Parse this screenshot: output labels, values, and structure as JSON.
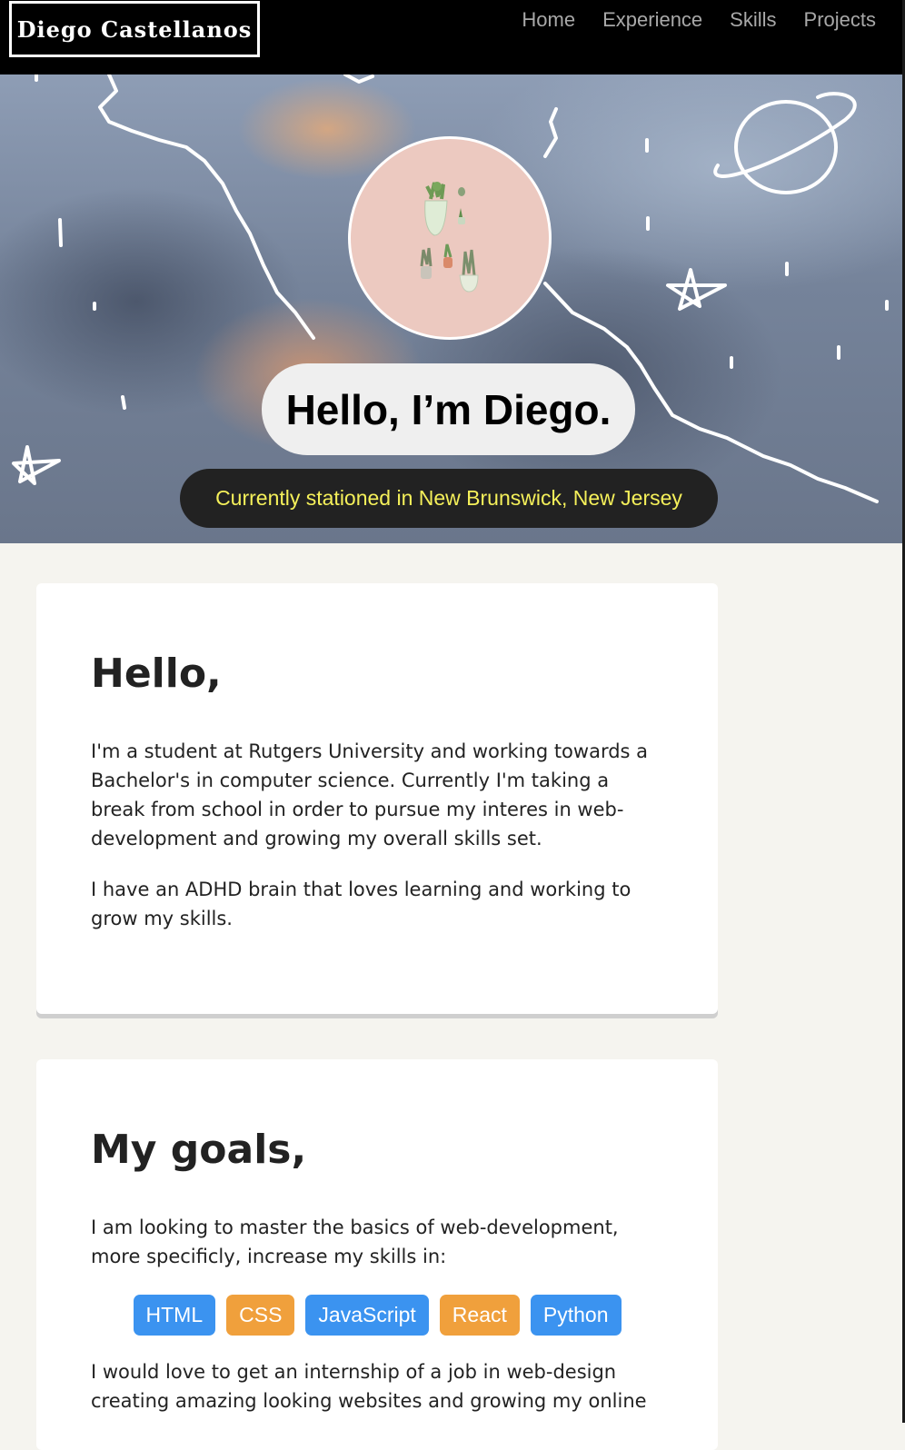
{
  "nav": {
    "brand": "Diego Castellanos",
    "links": [
      {
        "label": "Home"
      },
      {
        "label": "Experience"
      },
      {
        "label": "Skills"
      },
      {
        "label": "Projects"
      }
    ]
  },
  "hero": {
    "avatar_icon": "succulents-illustration",
    "title": "Hello, I’m Diego.",
    "subtitle": "Currently stationed in New Brunswick, New Jersey"
  },
  "about": {
    "heading": "Hello,",
    "paragraphs": [
      "I'm a student at Rutgers University and working towards a Bachelor's in computer science. Currently I'm taking a break from school in order to pursue my interes in web-development and growing my overall skills set.",
      "I have an ADHD brain that loves learning and working to grow my skills."
    ]
  },
  "goals": {
    "heading": "My goals,",
    "intro": "I am looking to master the basics of web-development, more specificly, increase my skills in:",
    "skills": [
      {
        "label": "HTML",
        "color": "#3b93f0"
      },
      {
        "label": "CSS",
        "color": "#f0a03c"
      },
      {
        "label": "JavaScript",
        "color": "#3b93f0"
      },
      {
        "label": "React",
        "color": "#f0a03c"
      },
      {
        "label": "Python",
        "color": "#3b93f0"
      }
    ],
    "closing": "I would love to get an internship of a job in web-design creating amazing looking websites and growing my online"
  },
  "colors": {
    "nav_bg": "#000000",
    "subtitle_text": "#f5f05a",
    "tag_blue": "#3b93f0",
    "tag_orange": "#f0a03c"
  }
}
